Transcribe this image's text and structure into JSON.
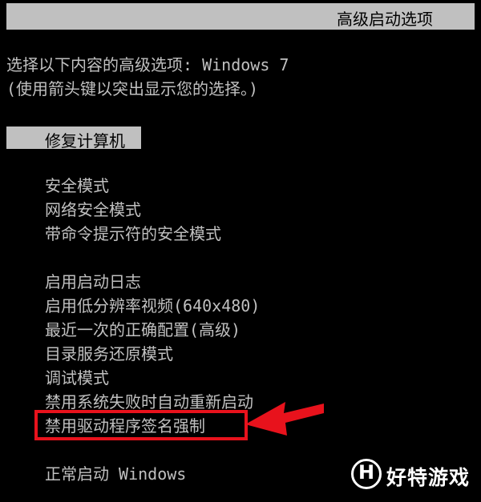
{
  "header": {
    "title": "高级启动选项"
  },
  "prompt": {
    "line1": "选择以下内容的高级选项: Windows 7",
    "line2": "(使用箭头键以突出显示您的选择。)"
  },
  "menu": {
    "selected": "修复计算机",
    "group1": [
      "安全模式",
      "网络安全模式",
      "带命令提示符的安全模式"
    ],
    "group2": [
      "启用启动日志",
      "启用低分辨率视频(640x480)",
      "最近一次的正确配置(高级)",
      "目录服务还原模式",
      "调试模式",
      "禁用系统失败时自动重新启动",
      "禁用驱动程序签名强制"
    ],
    "normal": "正常启动 Windows"
  },
  "annotation": {
    "color": "#e8121c",
    "target_index": 6
  },
  "watermark": {
    "letter": "H",
    "text": "好特游戏"
  }
}
